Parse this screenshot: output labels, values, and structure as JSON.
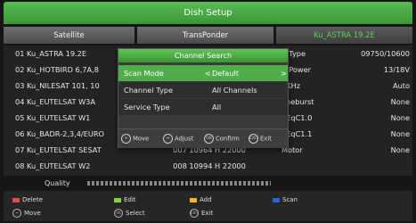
{
  "title": "Dish Setup",
  "columns": {
    "satellite": "Satellite",
    "transponder": "TransPonder",
    "selected_satellite": "Ku_ASTRA 19.2E"
  },
  "satellites": [
    "01 Ku_ASTRA 19.2E",
    "02 Ku_HOTBIRD 6,7A,8",
    "03 Ku_NILESAT 101, 10",
    "04 Ku_EUTELSAT W3A",
    "05 Ku_EUTELSAT W1",
    "06 Ku_BADR-2,3,4/EURO",
    "07 Ku_EUTELSAT SESAT",
    "08 Ku_EUTELSAT W2"
  ],
  "transponders": [
    {
      "label": "007 10964 H 22000"
    },
    {
      "label": "008 10994 H 22000"
    }
  ],
  "params": [
    {
      "label": "B Type",
      "value": "09750/10600"
    },
    {
      "label": "B Power",
      "value": "13/18V"
    },
    {
      "label": "2KHz",
      "value": "Auto"
    },
    {
      "label": "oneburst",
      "value": "None"
    },
    {
      "label": "SEqC1.0",
      "value": "None"
    },
    {
      "label": "SEqC1.1",
      "value": "None"
    },
    {
      "label": "Motor",
      "value": "None"
    }
  ],
  "dialog": {
    "title": "Channel Search",
    "rows": [
      {
        "label": "Scan Mode",
        "value": "Default",
        "left_arrow": "<",
        "right_arrow": ">"
      },
      {
        "label": "Channel Type",
        "value": "All Channels"
      },
      {
        "label": "Service Type",
        "value": "All"
      }
    ],
    "footer": {
      "move": "Move",
      "adjust": "Adjust",
      "confirm": "Confirm",
      "exit": "Exit"
    }
  },
  "quality_label": "Quality",
  "keys": {
    "delete": "Delete",
    "edit": "Edit",
    "add": "Add",
    "scan": "Scan",
    "move": "Move",
    "select": "Select",
    "exit": "Exit"
  },
  "key_icons": {
    "select": "OK",
    "exit": "EXIT",
    "confirm": "OK"
  },
  "colors": {
    "accent_green": "#4fae4a",
    "delete": "#e04b4b",
    "edit": "#7fd34a",
    "add": "#f3b820",
    "scan": "#2a63d8"
  }
}
